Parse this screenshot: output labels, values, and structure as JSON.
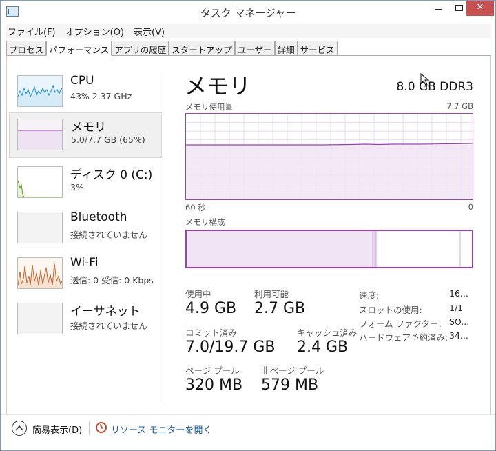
{
  "window": {
    "title": "タスク マネージャー",
    "minimize": "—",
    "close": "✕"
  },
  "menu": [
    "ファイル(F)",
    "オプション(O)",
    "表示(V)"
  ],
  "tabs": [
    "プロセス",
    "パフォーマンス",
    "アプリの履歴",
    "スタートアップ",
    "ユーザー",
    "詳細",
    "サービス"
  ],
  "active_tab": "パフォーマンス",
  "sidebar": {
    "items": [
      {
        "title": "CPU",
        "sub": "43%  2.37 GHz",
        "color": "#1f8dd6"
      },
      {
        "title": "メモリ",
        "sub": "5.0/7.7 GB (65%)",
        "color": "#9b3fb5"
      },
      {
        "title": "ディスク 0 (C:)",
        "sub": "3%",
        "color": "#4da60c"
      },
      {
        "title": "Bluetooth",
        "sub": "接続されていません",
        "color": "#bbbbbb"
      },
      {
        "title": "Wi-Fi",
        "sub": "送信: 0  受信: 0 Kbps",
        "color": "#c0632a"
      },
      {
        "title": "イーサネット",
        "sub": "接続されていません",
        "color": "#bbbbbb"
      }
    ]
  },
  "main": {
    "title": "メモリ",
    "spec": "8.0 GB DDR3",
    "usage_label": "メモリ使用量",
    "usage_max": "7.7 GB",
    "usage_fraction": 0.65,
    "axis_left": "60 秒",
    "axis_right": "0",
    "composition_label": "メモリ構成",
    "composition": {
      "in_use_fraction": 0.65,
      "modified_fraction": 0.01,
      "standby_fraction": 0.3
    },
    "stats": {
      "in_use_label": "使用中",
      "in_use": "4.9 GB",
      "available_label": "利用可能",
      "available": "2.7 GB",
      "committed_label": "コミット済み",
      "committed": "7.0/19.7 GB",
      "cached_label": "キャッシュ済み",
      "cached": "2.4 GB",
      "paged_label": "ページ プール",
      "paged": "320 MB",
      "nonpaged_label": "非ページ プール",
      "nonpaged": "579 MB"
    },
    "details": [
      {
        "label": "速度:",
        "value": "16..."
      },
      {
        "label": "スロットの使用:",
        "value": "1/1"
      },
      {
        "label": "フォーム ファクター:",
        "value": "SO..."
      },
      {
        "label": "ハードウェア予約済み:",
        "value": "34..."
      }
    ]
  },
  "footer": {
    "fewer_details": "簡易表示(D)",
    "resource_monitor": "リソース モニターを開く"
  }
}
